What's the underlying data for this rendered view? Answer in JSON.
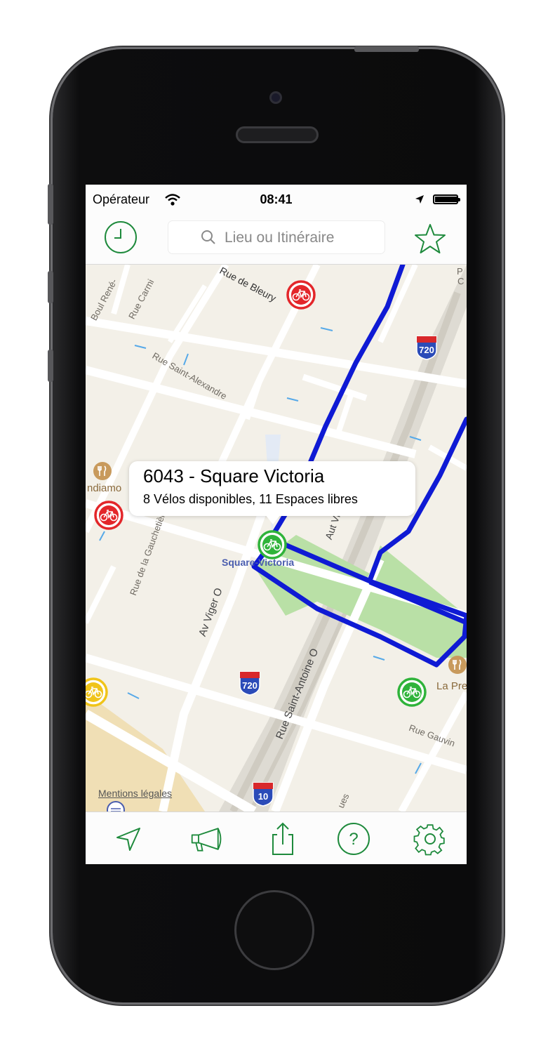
{
  "status_bar": {
    "carrier": "Opérateur",
    "time": "08:41"
  },
  "nav_bar": {
    "search_placeholder": "Lieu ou Itinéraire"
  },
  "map": {
    "streets": [
      "Boul René-",
      "Rue Carmi",
      "Rue de Bleury",
      "Rue Saint-Alexandre",
      "Rue de la Gauchetière",
      "Av Viger O",
      "Rue Saint-Antoine O",
      "Aut Ville-Marie",
      "Rue Gauvin",
      "ues",
      "P",
      "C"
    ],
    "highway_shields": [
      "720",
      "720",
      "10"
    ],
    "poi_labels": [
      "ndiamo",
      "La Pre"
    ],
    "station_label": "Square-Victoria",
    "legal_link": "Mentions légales"
  },
  "callout": {
    "title": "6043 - Square Victoria",
    "subtitle": "8 Vélos disponibles, 11 Espaces libres"
  },
  "colors": {
    "accent": "#1e8a3c",
    "route": "#0f1ad4",
    "station_green": "#2fb33a",
    "station_red": "#e3262a",
    "station_yellow": "#f0c419",
    "park": "#b9e0a6"
  },
  "toolbar": {
    "icons": [
      "location-arrow-icon",
      "megaphone-icon",
      "share-icon",
      "help-icon",
      "settings-gear-icon"
    ],
    "help_glyph": "?"
  }
}
